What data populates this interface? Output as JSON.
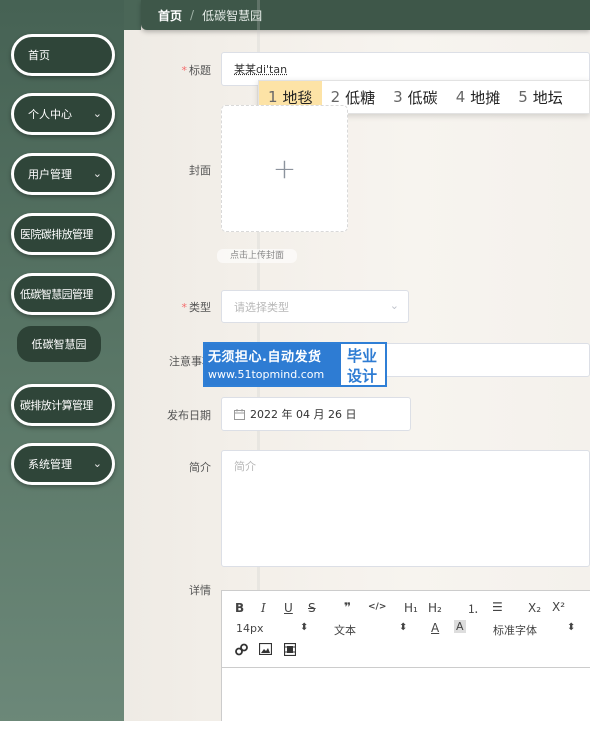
{
  "sidebar": {
    "items": [
      {
        "label": "首页",
        "has_chevron": false
      },
      {
        "label": "个人中心",
        "has_chevron": true
      },
      {
        "label": "用户管理",
        "has_chevron": true
      },
      {
        "label": "医院碳排放管理",
        "has_chevron": false
      },
      {
        "label": "低碳智慧园管理",
        "has_chevron": false
      },
      {
        "label": "碳排放计算管理",
        "has_chevron": false
      },
      {
        "label": "系统管理",
        "has_chevron": true
      }
    ],
    "sub_item": "低碳智慧园",
    "chevron": "⌄"
  },
  "breadcrumb": {
    "home": "首页",
    "separator": "/",
    "current": "低碳智慧园"
  },
  "form": {
    "title_label": "标题",
    "title_value": "某某di'tan",
    "cover_label": "封面",
    "upload_plus": "+",
    "upload_hint": "点击上传封面",
    "type_label": "类型",
    "type_placeholder": "请选择类型",
    "notes_label": "注意事项",
    "date_label": "发布日期",
    "date_value": "2022 年 04 月 26 日",
    "intro_label": "简介",
    "intro_placeholder": "简介",
    "detail_label": "详情",
    "required_mark": "*"
  },
  "ime": {
    "candidates": [
      {
        "num": "1",
        "text": "地毯"
      },
      {
        "num": "2",
        "text": "低糖"
      },
      {
        "num": "3",
        "text": "低碳"
      },
      {
        "num": "4",
        "text": "地摊"
      },
      {
        "num": "5",
        "text": "地坛"
      }
    ]
  },
  "watermark": {
    "line1": "无须担心.自动发货",
    "line2": "www.51topmind.com",
    "right1": "毕业",
    "right2": "设计"
  },
  "editor": {
    "bold": "B",
    "italic": "I",
    "underline": "U",
    "strike": "S",
    "quote": "❞",
    "code": "</>",
    "h1": "H₁",
    "h2": "H₂",
    "ol": "⒈",
    "ul": "☰",
    "sub": "X₂",
    "sup": "X²",
    "font_size": "14px",
    "text_style": "文本",
    "font_family": "标准字体",
    "font_color": "A",
    "bg_color": "A",
    "stepper": "⬍"
  },
  "colors": {
    "sidebar": "#466254",
    "sidebar_item": "#2f4539",
    "topbar": "#3e5749",
    "required": "#f56c6c",
    "ime_selected": "#fde3a6",
    "watermark_blue": "#2e7cd3"
  }
}
